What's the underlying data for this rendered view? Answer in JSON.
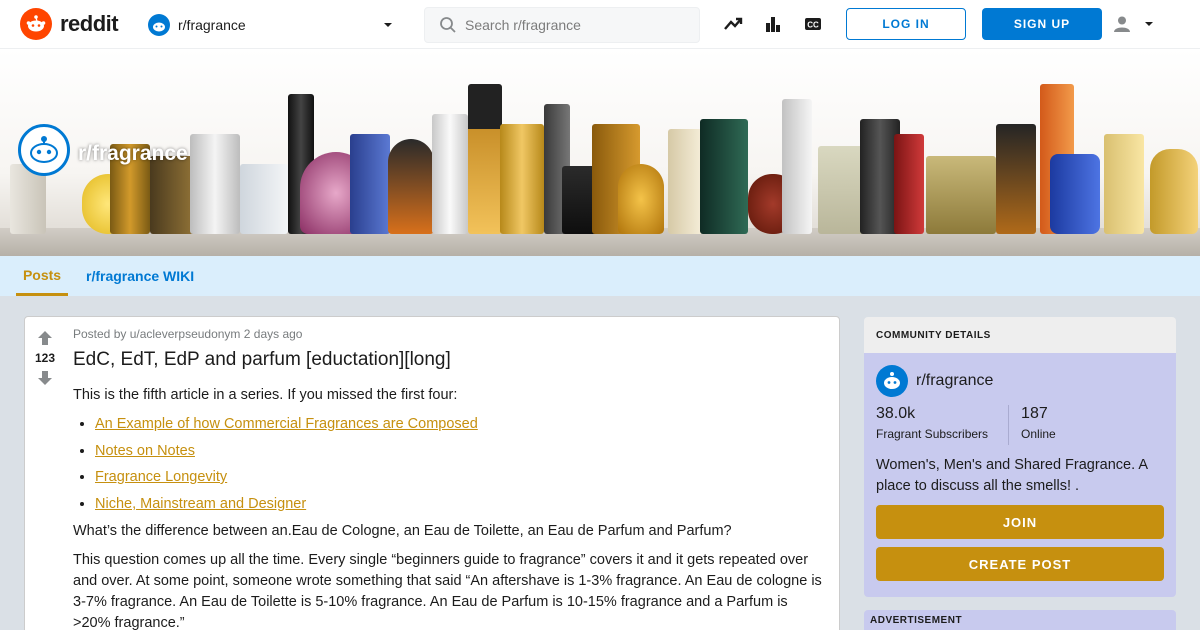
{
  "header": {
    "logo_text": "reddit",
    "community": "r/fragrance",
    "search_placeholder": "Search r/fragrance",
    "login_label": "LOG IN",
    "signup_label": "SIGN UP",
    "icons": [
      "trending-icon",
      "stats-icon",
      "closed-caption-icon",
      "user-icon",
      "chevron-down-icon"
    ]
  },
  "banner": {
    "community_title": "r/fragrance"
  },
  "subnav": {
    "tabs": [
      {
        "label": "Posts",
        "active": true
      },
      {
        "label": "r/fragrance WIKI",
        "active": false
      }
    ]
  },
  "post": {
    "votes": "123",
    "meta": "Posted by u/acleverpseudonym 2 days ago",
    "title": "EdC, EdT, EdP and parfum [eductation][long]",
    "intro": "This is the fifth article in a series. If you missed the first four:",
    "links": [
      "An Example of how Commercial Fragrances are Composed",
      "Notes on Notes",
      "Fragrance Longevity",
      "Niche, Mainstream and Designer"
    ],
    "question": "What’s the difference between an.Eau de Cologne, an Eau de Toilette, an Eau de Parfum and Parfum?",
    "paragraph": "This question comes up all the time. Every single “beginners guide to fragrance” covers it and it gets repeated over and over. At some point, someone wrote something that said “An aftershave is 1-3% fragrance. An Eau de cologne is 3-7% fragrance. An Eau de Toilette is 5-10% fragrance. An Eau de Parfum is 10-15% fragrance and a Parfum is >20% fragrance.”"
  },
  "sidebar": {
    "heading": "COMMUNITY DETAILS",
    "community": "r/fragrance",
    "subscribers": "38.0k",
    "subscribers_label": "Fragrant Subscribers",
    "online": "187",
    "online_label": "Online",
    "description": "Women's, Men's and Shared Fragrance. A place to discuss all the smells! .",
    "join_label": "JOIN",
    "create_label": "CREATE POST",
    "ad_label": "ADVERTISEMENT"
  },
  "colors": {
    "accent": "#c6900f",
    "brand": "#ff4500",
    "blue": "#0079d3",
    "subnav": "#daeefc",
    "sidebar": "#c8caee"
  }
}
